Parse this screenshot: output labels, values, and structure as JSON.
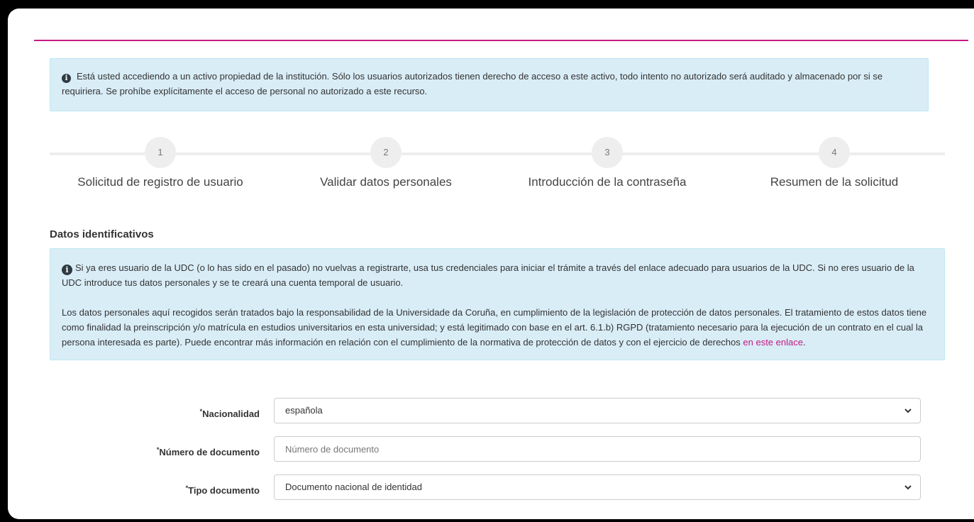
{
  "banner": {
    "icon": "info-circle-icon",
    "text": "Está usted accediendo a un activo propiedad de la institución. Sólo los usuarios autorizados tienen derecho de acceso a este activo, todo intento no autorizado será auditado y almacenado por si se requiriera. Se prohíbe explícitamente el acceso de personal no autorizado a este recurso."
  },
  "steps": [
    {
      "num": "1",
      "label": "Solicitud de registro de usuario"
    },
    {
      "num": "2",
      "label": "Validar datos personales"
    },
    {
      "num": "3",
      "label": "Introducción de la contraseña"
    },
    {
      "num": "4",
      "label": "Resumen de la solicitud"
    }
  ],
  "section": {
    "title": "Datos identificativos"
  },
  "info": {
    "icon": "info-circle-icon",
    "paragraph1": "Si ya eres usuario de la UDC (o lo has sido en el pasado) no vuelvas a registrarte, usa tus credenciales para iniciar el trámite a través del enlace adecuado para usuarios de la UDC. Si no eres usuario de la UDC introduce tus datos personales y se te creará una cuenta temporal de usuario.",
    "paragraph2": "Los datos personales aquí recogidos serán tratados bajo la responsabilidad de la Universidade da Coruña, en cumplimiento de la legislación de protección de datos personales. El tratamiento de estos datos tiene como finalidad la preinscripción y/o matrícula en estudios universitarios en esta universidad; y está legitimado con base en el art. 6.1.b) RGPD (tratamiento necesario para la ejecución de un contrato en el cual la persona interesada es parte). Puede encontrar más información en relación con el cumplimiento de la normativa de protección de datos y con el ejercicio de derechos",
    "link_text": "en este enlace",
    "after_link": "."
  },
  "form": {
    "required_mark": "*",
    "nacionalidad": {
      "label": "Nacionalidad",
      "value": "española"
    },
    "numero_documento": {
      "label": "Número de documento",
      "value": "",
      "placeholder": "Número de documento"
    },
    "tipo_documento": {
      "label": "Tipo documento",
      "value": "Documento nacional de identidad"
    }
  },
  "colors": {
    "accent": "#c51a84",
    "info_bg": "#d9edf7",
    "step_bg": "#eeeeee"
  }
}
